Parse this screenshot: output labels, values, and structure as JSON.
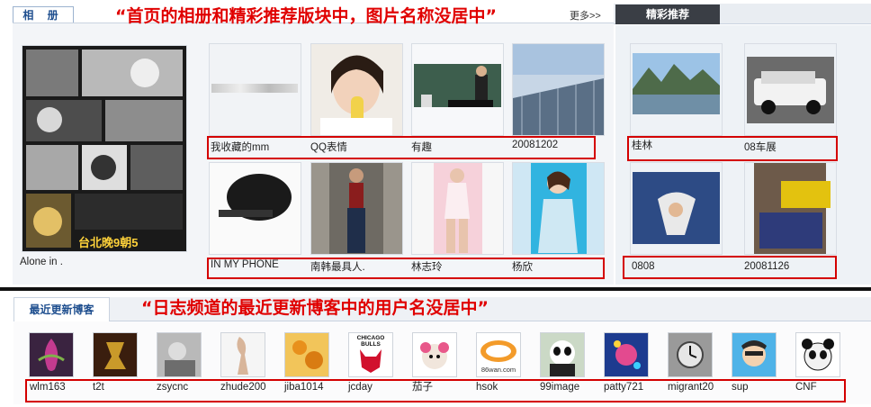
{
  "album": {
    "tab_label": "相 册",
    "annotation": "“首页的相册和精彩推荐版块中，图片名称没居中”",
    "more_link": "更多>>",
    "featured_caption": "Alone in .",
    "poster_text": "台北晚9朝5",
    "row1": [
      "我收藏的mm",
      "QQ表情",
      "有趣",
      "20081202"
    ],
    "row2": [
      "IN MY PHONE",
      "南韩最具人.",
      "林志玲",
      "杨欣"
    ]
  },
  "recommend": {
    "tab_label": "精彩推荐",
    "row1": [
      "桂林",
      "08车展"
    ],
    "row2": [
      "0808",
      "20081126"
    ]
  },
  "recent": {
    "tab_label": "最近更新博客",
    "annotation": "“日志频道的最近更新博客中的用户名没居中”",
    "users": [
      "wlm163",
      "t2t",
      "zsycnc",
      "zhude200",
      "jiba1014",
      "jcday",
      "茄子",
      "hsok",
      "99image",
      "patty721",
      "migrant20",
      "sup",
      "CNF"
    ],
    "bulls_text": "CHICAGO BULLS",
    "game_text": "86wan.com"
  },
  "colors": {
    "annotation_red": "#e00000",
    "box_red": "#d40000",
    "tab_dark": "#3a3e45",
    "tab_blue": "#1f4f8f"
  }
}
